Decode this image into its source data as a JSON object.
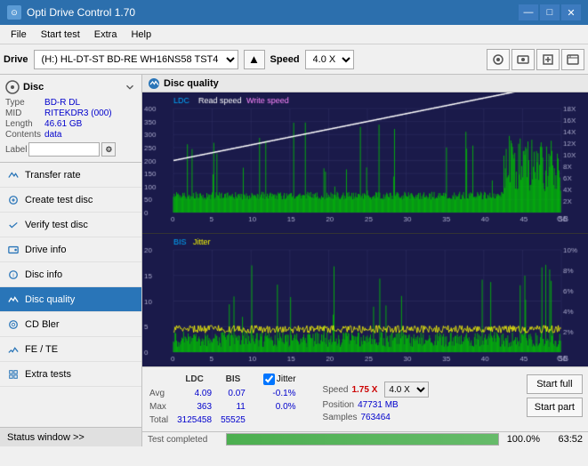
{
  "titleBar": {
    "title": "Opti Drive Control 1.70",
    "minimizeLabel": "—",
    "maximizeLabel": "□",
    "closeLabel": "✕"
  },
  "menuBar": {
    "items": [
      "File",
      "Start test",
      "Extra",
      "Help"
    ]
  },
  "driveBar": {
    "driveLabel": "Drive",
    "driveValue": "(H:) HL-DT-ST BD-RE  WH16NS58 TST4",
    "speedLabel": "Speed",
    "speedValue": "4.0 X"
  },
  "disc": {
    "title": "Disc",
    "typeLabel": "Type",
    "typeValue": "BD-R DL",
    "midLabel": "MID",
    "midValue": "RITEKDR3 (000)",
    "lengthLabel": "Length",
    "lengthValue": "46.61 GB",
    "contentsLabel": "Contents",
    "contentsValue": "data",
    "labelLabel": "Label",
    "labelValue": ""
  },
  "navItems": [
    {
      "id": "transfer-rate",
      "label": "Transfer rate",
      "active": false
    },
    {
      "id": "create-test-disc",
      "label": "Create test disc",
      "active": false
    },
    {
      "id": "verify-test-disc",
      "label": "Verify test disc",
      "active": false
    },
    {
      "id": "drive-info",
      "label": "Drive info",
      "active": false
    },
    {
      "id": "disc-info",
      "label": "Disc info",
      "active": false
    },
    {
      "id": "disc-quality",
      "label": "Disc quality",
      "active": true
    },
    {
      "id": "cd-bler",
      "label": "CD Bler",
      "active": false
    },
    {
      "id": "fe-te",
      "label": "FE / TE",
      "active": false
    },
    {
      "id": "extra-tests",
      "label": "Extra tests",
      "active": false
    }
  ],
  "statusWindow": "Status window >>",
  "discQuality": {
    "title": "Disc quality",
    "legend": {
      "ldc": "LDC",
      "readSpeed": "Read speed",
      "writeSpeed": "Write speed",
      "bis": "BIS",
      "jitter": "Jitter"
    },
    "topChartYMax": 400,
    "topChartYRight": 18,
    "bottomChartYMax": 20,
    "bottomChartYRight": 10
  },
  "stats": {
    "headers": [
      "",
      "LDC",
      "BIS",
      "",
      "Jitter",
      "Speed",
      "",
      ""
    ],
    "avgLabel": "Avg",
    "maxLabel": "Max",
    "totalLabel": "Total",
    "avgLDC": "4.09",
    "avgBIS": "0.07",
    "avgJitter": "-0.1%",
    "maxLDC": "363",
    "maxBIS": "11",
    "maxJitter": "0.0%",
    "totalLDC": "3125458",
    "totalBIS": "55525",
    "jitterChecked": true,
    "speedLabel": "Speed",
    "speedValue": "1.75 X",
    "speedSelectValue": "4.0 X",
    "positionLabel": "Position",
    "positionValue": "47731 MB",
    "samplesLabel": "Samples",
    "samplesValue": "763464",
    "startFullLabel": "Start full",
    "startPartLabel": "Start part"
  },
  "progressBar": {
    "percent": 100,
    "percentLabel": "100.0%",
    "timeLabel": "63:52"
  },
  "statusText": "Test completed"
}
